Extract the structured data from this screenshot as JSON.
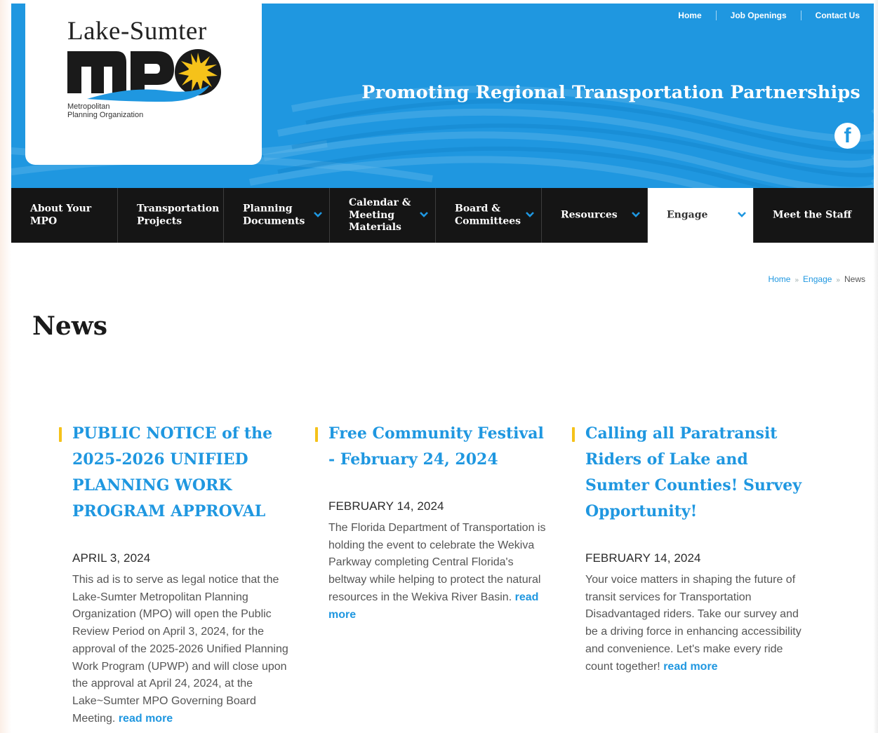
{
  "header": {
    "logo": {
      "title": "Lake-Sumter",
      "mark": "MPO",
      "subtitle_line1": "Metropolitan",
      "subtitle_line2": "Planning Organization"
    },
    "top_links": [
      "Home",
      "Job Openings",
      "Contact Us"
    ],
    "tagline": "Promoting Regional Transportation Partnerships",
    "social_icon": "facebook-icon",
    "colors": {
      "brand_blue": "#1f97e0",
      "accent_yellow": "#f5c21a",
      "nav_black": "#151515"
    }
  },
  "nav": {
    "items": [
      {
        "label": "About Your\nMPO",
        "has_dropdown": false
      },
      {
        "label": "Transportation\nProjects",
        "has_dropdown": false
      },
      {
        "label": "Planning\nDocuments",
        "has_dropdown": true
      },
      {
        "label": "Calendar &\nMeeting\nMaterials",
        "has_dropdown": true
      },
      {
        "label": "Board &\nCommittees",
        "has_dropdown": true
      },
      {
        "label": "Resources",
        "has_dropdown": true
      },
      {
        "label": "Engage",
        "has_dropdown": true,
        "active": true
      },
      {
        "label": "Meet the Staff",
        "has_dropdown": false
      }
    ]
  },
  "breadcrumb": {
    "home": "Home",
    "section": "Engage",
    "current": "News"
  },
  "page": {
    "title": "News"
  },
  "articles": [
    {
      "title": "PUBLIC NOTICE of the 2025-2026 UNIFIED PLANNING WORK PROGRAM APPROVAL",
      "date": "APRIL 3, 2024",
      "excerpt": "This ad is to serve as legal notice that the Lake-Sumter Metropolitan Planning Organization (MPO) will open the Public Review Period on April 3, 2024, for the approval of the 2025-2026 Unified Planning Work Program (UPWP) and will close upon the approval at April 24, 2024, at the Lake~Sumter MPO Governing Board Meeting.",
      "read_more": "read more"
    },
    {
      "title": "Free Community Festival - February 24, 2024",
      "date": "FEBRUARY 14, 2024",
      "excerpt": "The Florida Department of Transportation is holding the event to celebrate the Wekiva Parkway completing Central Florida's beltway while helping to protect the natural resources in the Wekiva River Basin.",
      "read_more": "read more"
    },
    {
      "title": "Calling all Paratransit Riders of Lake and Sumter Counties! Survey Opportunity!",
      "date": "FEBRUARY 14, 2024",
      "excerpt": "Your voice matters in shaping the future of transit services for Transportation Disadvantaged riders. Take our survey and be a driving force in enhancing accessibility and convenience. Let's make every ride count together!",
      "read_more": "read more"
    }
  ]
}
